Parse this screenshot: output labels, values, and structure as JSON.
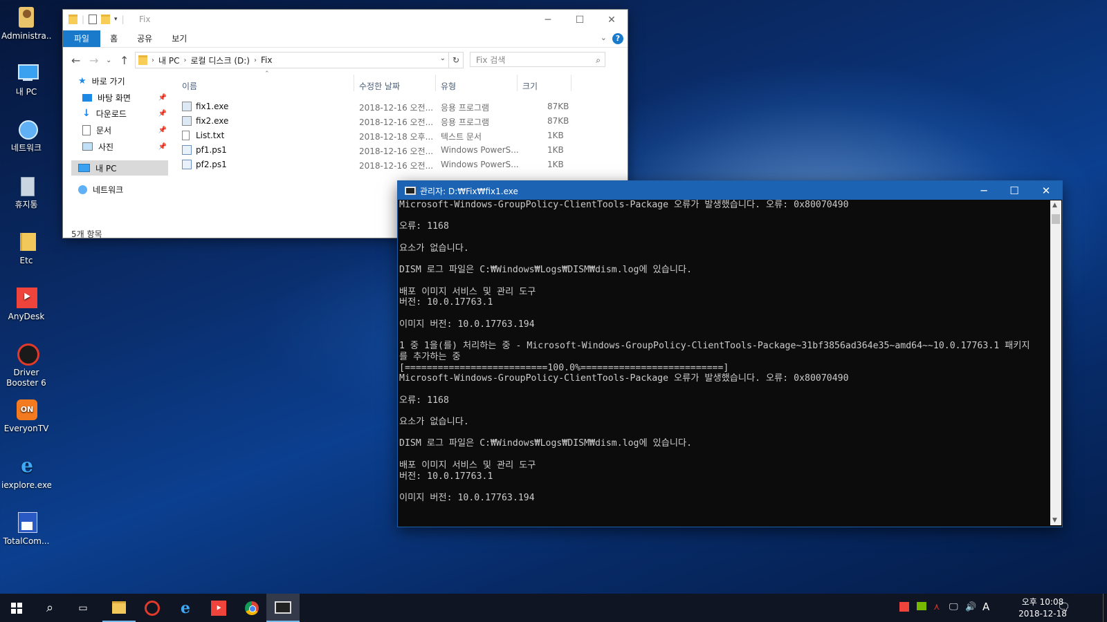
{
  "desktop": {
    "icons": [
      {
        "label": "Administra..."
      },
      {
        "label": "내 PC"
      },
      {
        "label": "네트워크"
      },
      {
        "label": "휴지통"
      },
      {
        "label": "Etc"
      },
      {
        "label": "AnyDesk"
      },
      {
        "label": "Driver Booster 6"
      },
      {
        "label": "EveryonTV"
      },
      {
        "label": "iexplore.exe"
      },
      {
        "label": "TotalCom..."
      }
    ]
  },
  "explorer": {
    "title": "Fix",
    "ribbon_tabs": [
      "파일",
      "홈",
      "공유",
      "보기"
    ],
    "breadcrumb": [
      "내 PC",
      "로컬 디스크 (D:)",
      "Fix"
    ],
    "search_placeholder": "Fix 검색",
    "sidebar": {
      "quick_access": "바로 가기",
      "pinned": [
        "바탕 화면",
        "다운로드",
        "문서",
        "사진"
      ],
      "this_pc": "내 PC",
      "network": "네트워크"
    },
    "columns": [
      "이름",
      "수정한 날짜",
      "유형",
      "크기"
    ],
    "files": [
      {
        "name": "fix1.exe",
        "date": "2018-12-16 오전...",
        "type": "응용 프로그램",
        "size": "87KB",
        "icon": "exe-icon"
      },
      {
        "name": "fix2.exe",
        "date": "2018-12-16 오전...",
        "type": "응용 프로그램",
        "size": "87KB",
        "icon": "exe-icon"
      },
      {
        "name": "List.txt",
        "date": "2018-12-18 오후...",
        "type": "텍스트 문서",
        "size": "1KB",
        "icon": "text-file-icon"
      },
      {
        "name": "pf1.ps1",
        "date": "2018-12-16 오전...",
        "type": "Windows PowerS...",
        "size": "1KB",
        "icon": "powershell-file-icon"
      },
      {
        "name": "pf2.ps1",
        "date": "2018-12-16 오전...",
        "type": "Windows PowerS...",
        "size": "1KB",
        "icon": "powershell-file-icon"
      }
    ],
    "status": "5개 항목"
  },
  "console": {
    "title": "관리자: D:₩Fix₩fix1.exe",
    "lines": [
      "Microsoft-Windows-GroupPolicy-ClientTools-Package 오류가 발생했습니다. 오류: 0x80070490",
      "",
      "오류: 1168",
      "",
      "요소가 없습니다.",
      "",
      "DISM 로그 파일은 C:₩Windows₩Logs₩DISM₩dism.log에 있습니다.",
      "",
      "배포 이미지 서비스 및 관리 도구",
      "버전: 10.0.17763.1",
      "",
      "이미지 버전: 10.0.17763.194",
      "",
      "1 중 1을(를) 처리하는 중 - Microsoft-Windows-GroupPolicy-ClientTools-Package~31bf3856ad364e35~amd64~~10.0.17763.1 패키지",
      "를 추가하는 중",
      "[==========================100.0%==========================]",
      "Microsoft-Windows-GroupPolicy-ClientTools-Package 오류가 발생했습니다. 오류: 0x80070490",
      "",
      "오류: 1168",
      "",
      "요소가 없습니다.",
      "",
      "DISM 로그 파일은 C:₩Windows₩Logs₩DISM₩dism.log에 있습니다.",
      "",
      "배포 이미지 서비스 및 관리 도구",
      "버전: 10.0.17763.1",
      "",
      "이미지 버전: 10.0.17763.194"
    ]
  },
  "taskbar": {
    "clock_time": "오후 10:08",
    "clock_date": "2018-12-18",
    "ime": "A",
    "accent_color": "#76b9ed"
  }
}
